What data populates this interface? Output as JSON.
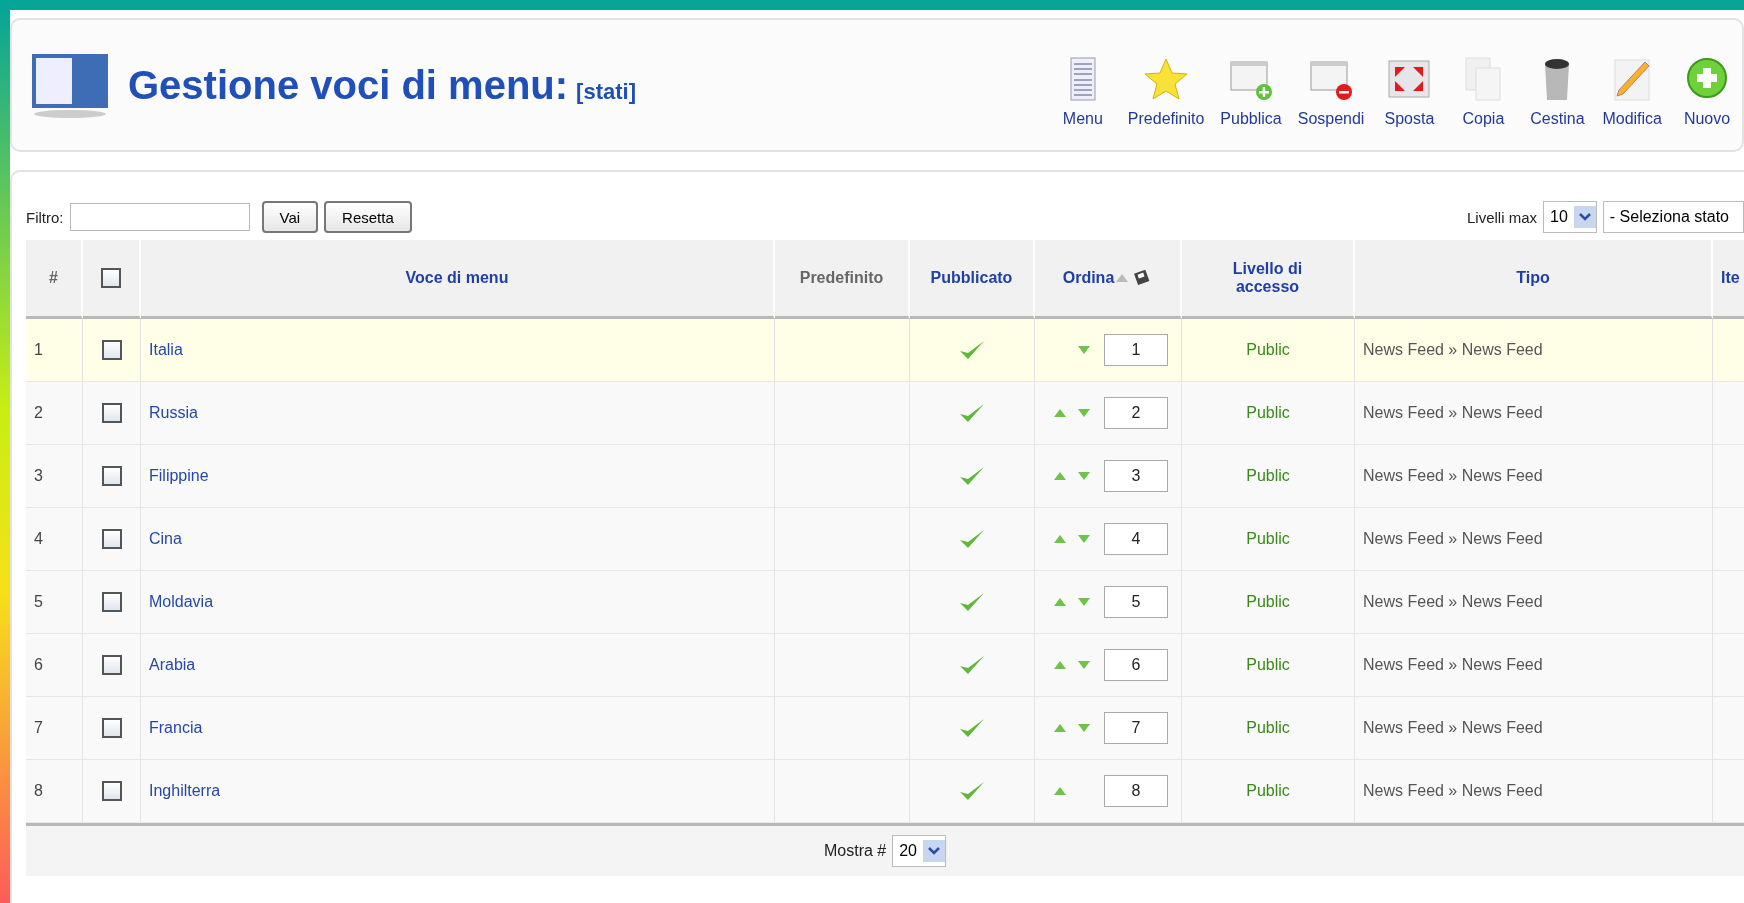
{
  "header": {
    "title": "Gestione voci di menu:",
    "subtitle": "[stati]"
  },
  "toolbar": [
    {
      "kind": "menu",
      "label": "Menu",
      "disabled": false
    },
    {
      "kind": "star",
      "label": "Predefinito",
      "disabled": false
    },
    {
      "kind": "publish",
      "label": "Pubblica",
      "disabled": false
    },
    {
      "kind": "unpublish",
      "label": "Sospendi",
      "disabled": false
    },
    {
      "kind": "move",
      "label": "Sposta",
      "disabled": false
    },
    {
      "kind": "copy",
      "label": "Copia",
      "disabled": false
    },
    {
      "kind": "trash",
      "label": "Cestina",
      "disabled": false
    },
    {
      "kind": "edit",
      "label": "Modifica",
      "disabled": false
    },
    {
      "kind": "new",
      "label": "Nuovo",
      "disabled": false
    }
  ],
  "filter": {
    "label": "Filtro:",
    "buttons": [
      "Vai",
      "Resetta"
    ]
  },
  "levels": {
    "label": "Livelli max",
    "value": "10",
    "state_select": "- Seleziona stato"
  },
  "table": {
    "select_all_checked": false,
    "columns": [
      "#",
      "Voce di menu",
      "Predefinito",
      "Pubblicato",
      "Ordina",
      "Livello di accesso",
      "Tipo",
      "Ite"
    ],
    "rows": [
      {
        "num": "1",
        "name": "Italia",
        "checked": false,
        "highlighted": true,
        "published": true,
        "up": false,
        "down": true,
        "order": "1",
        "access": "Public",
        "type": "News Feed » News Feed"
      },
      {
        "num": "2",
        "name": "Russia",
        "checked": false,
        "highlighted": false,
        "published": true,
        "up": true,
        "down": true,
        "order": "2",
        "access": "Public",
        "type": "News Feed » News Feed"
      },
      {
        "num": "3",
        "name": "Filippine",
        "checked": false,
        "highlighted": false,
        "published": true,
        "up": true,
        "down": true,
        "order": "3",
        "access": "Public",
        "type": "News Feed » News Feed"
      },
      {
        "num": "4",
        "name": "Cina",
        "checked": false,
        "highlighted": false,
        "published": true,
        "up": true,
        "down": true,
        "order": "4",
        "access": "Public",
        "type": "News Feed » News Feed"
      },
      {
        "num": "5",
        "name": "Moldavia",
        "checked": false,
        "highlighted": false,
        "published": true,
        "up": true,
        "down": true,
        "order": "5",
        "access": "Public",
        "type": "News Feed » News Feed"
      },
      {
        "num": "6",
        "name": "Arabia",
        "checked": false,
        "highlighted": false,
        "published": true,
        "up": true,
        "down": true,
        "order": "6",
        "access": "Public",
        "type": "News Feed » News Feed"
      },
      {
        "num": "7",
        "name": "Francia",
        "checked": false,
        "highlighted": false,
        "published": true,
        "up": true,
        "down": true,
        "order": "7",
        "access": "Public",
        "type": "News Feed » News Feed"
      },
      {
        "num": "8",
        "name": "Inghilterra",
        "checked": false,
        "highlighted": false,
        "published": true,
        "up": true,
        "down": false,
        "order": "8",
        "access": "Public",
        "type": "News Feed » News Feed"
      }
    ]
  },
  "pagination": {
    "label": "Mostra #",
    "value": "20"
  }
}
